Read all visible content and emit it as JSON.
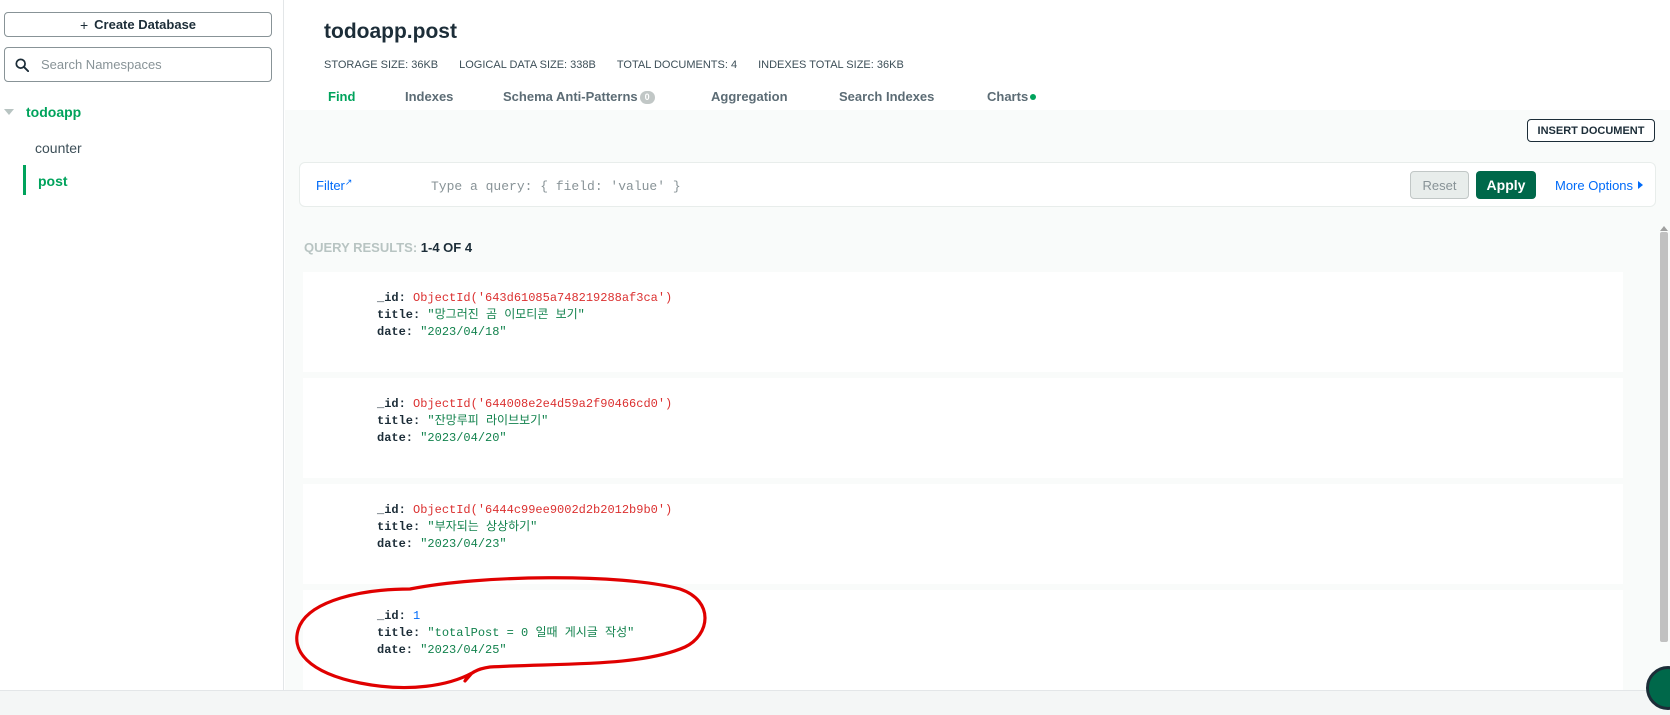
{
  "sidebar": {
    "create_database_label": "Create Database",
    "search_placeholder": "Search Namespaces",
    "database": "todoapp",
    "collections": [
      {
        "name": "counter"
      },
      {
        "name": "post"
      }
    ]
  },
  "header": {
    "title": "todoapp.post",
    "stats": [
      {
        "label": "STORAGE SIZE: 36KB"
      },
      {
        "label": "LOGICAL DATA SIZE: 338B"
      },
      {
        "label": "TOTAL DOCUMENTS: 4"
      },
      {
        "label": "INDEXES TOTAL SIZE: 36KB"
      }
    ]
  },
  "tabs": [
    {
      "label": "Find"
    },
    {
      "label": "Indexes"
    },
    {
      "label": "Schema Anti-Patterns",
      "badge": "0"
    },
    {
      "label": "Aggregation"
    },
    {
      "label": "Search Indexes"
    },
    {
      "label": "Charts"
    }
  ],
  "toolbar": {
    "insert_document_label": "INSERT DOCUMENT",
    "filter_label": "Filter",
    "query_placeholder": "Type a query: { field: 'value' }",
    "reset_label": "Reset",
    "apply_label": "Apply",
    "more_options_label": "More Options"
  },
  "results": {
    "label": "QUERY RESULTS: ",
    "count": "1-4 OF 4"
  },
  "documents": [
    {
      "id": "ObjectId('643d61085a748219288af3ca')",
      "title": "\"망그러진 곰 이모티콘 보기\"",
      "date": "\"2023/04/18\""
    },
    {
      "id": "ObjectId('644008e2e4d59a2f90466cd0')",
      "title": "\"잔망루피 라이브보기\"",
      "date": "\"2023/04/20\""
    },
    {
      "id": "ObjectId('6444c99ee9002d2b2012b9b0')",
      "title": "\"부자되는 상상하기\"",
      "date": "\"2023/04/23\""
    },
    {
      "id": "1",
      "title": "\"totalPost = 0 일때 게시글 작성\"",
      "date": "\"2023/04/25\""
    }
  ],
  "field_keys": {
    "id": "_id:",
    "title": "title:",
    "date": "date:"
  },
  "colors": {
    "accent": "#00a35c",
    "apply": "#00684a",
    "link": "#016bf8",
    "annotation": "#e00000"
  }
}
